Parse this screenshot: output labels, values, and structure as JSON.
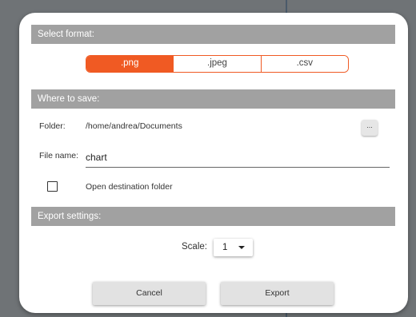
{
  "format_section": {
    "header": "Select format:",
    "options": [
      ".png",
      ".jpeg",
      ".csv"
    ],
    "selected": ".png"
  },
  "save_section": {
    "header": "Where to save:",
    "folder_label": "Folder:",
    "folder_path": "/home/andrea/Documents",
    "browse_label": "...",
    "file_name_label": "File name:",
    "file_name_value": "chart",
    "open_destination_label": "Open destination folder",
    "open_destination_checked": false
  },
  "export_section": {
    "header": "Export settings:",
    "scale_label": "Scale:",
    "scale_value": "1"
  },
  "actions": {
    "cancel_label": "Cancel",
    "export_label": "Export"
  },
  "colors": {
    "accent": "#f05a23",
    "section_header_bg": "#a1a1a1",
    "dialog_bg": "#ffffff",
    "button_bg": "#e2e2e2"
  }
}
